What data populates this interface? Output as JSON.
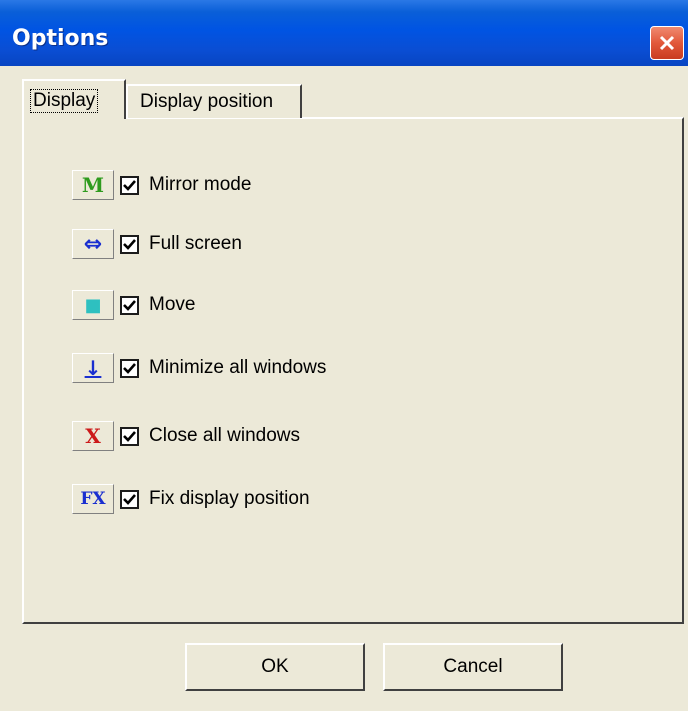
{
  "window": {
    "title": "Options"
  },
  "tabs": [
    {
      "label": "Display",
      "selected": true
    },
    {
      "label": "Display position",
      "selected": false
    }
  ],
  "options": [
    {
      "icon": "mirror-mode-icon",
      "icon_glyph": "M",
      "icon_color": "#2e9b1e",
      "checked": true,
      "label": "Mirror mode"
    },
    {
      "icon": "full-screen-icon",
      "icon_glyph": "⇔",
      "icon_color": "#1a2fd0",
      "checked": true,
      "label": "Full screen"
    },
    {
      "icon": "move-icon",
      "icon_glyph": "■",
      "icon_color": "#2ec0c0",
      "checked": true,
      "label": "Move"
    },
    {
      "icon": "minimize-all-icon",
      "icon_glyph": "↓",
      "icon_color": "#1a2fd0",
      "checked": true,
      "label": "Minimize all windows"
    },
    {
      "icon": "close-all-icon",
      "icon_glyph": "X",
      "icon_color": "#cc1a1a",
      "checked": true,
      "label": "Close all windows"
    },
    {
      "icon": "fix-display-icon",
      "icon_glyph": "FX",
      "icon_color": "#1a2fd0",
      "checked": true,
      "label": "Fix display position"
    }
  ],
  "buttons": {
    "ok_label": "OK",
    "cancel_label": "Cancel"
  },
  "colors": {
    "titlebar": "#0054e3",
    "face": "#ece9d8",
    "close": "#e2583a"
  }
}
